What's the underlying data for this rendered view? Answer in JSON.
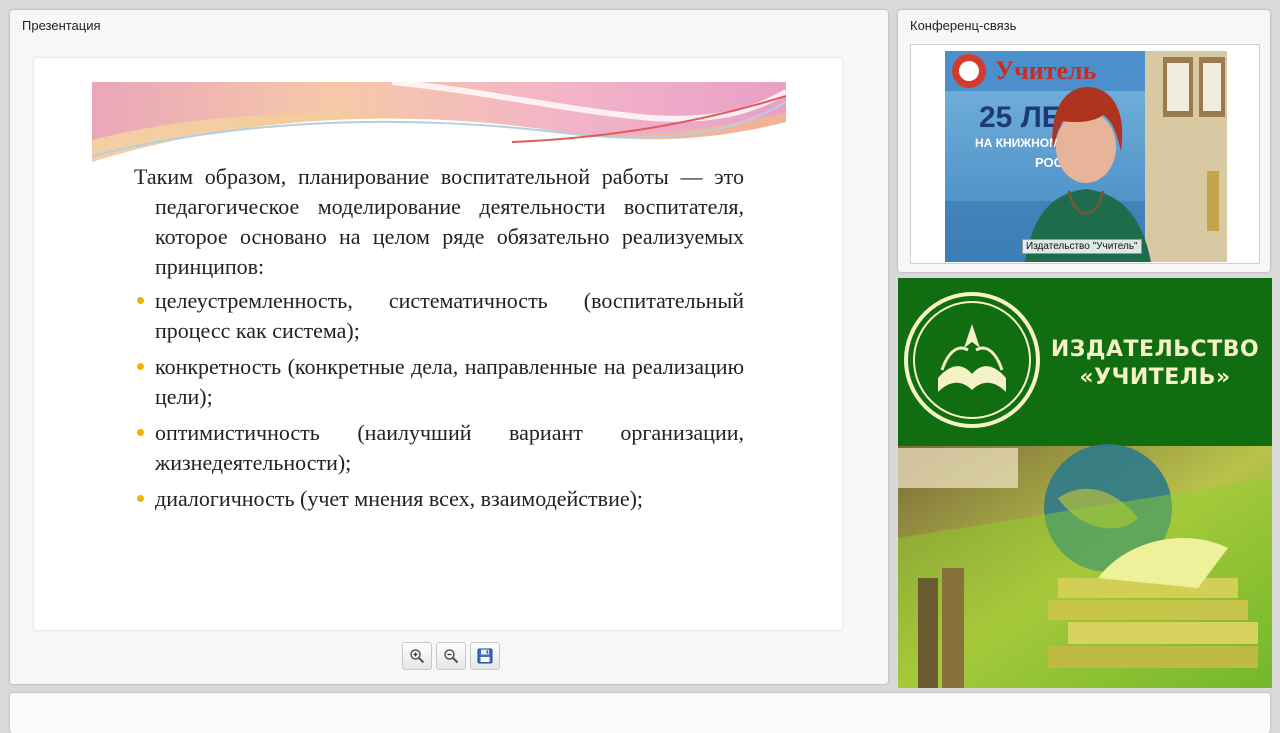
{
  "presentation_panel": {
    "title": "Презентация",
    "slide": {
      "intro": "Таким образом, планирование воспитательной работы — это педагогическое моделирование деятельности воспитателя, которое основано на целом ряде обязательно реализуемых принципов:",
      "bullets": [
        "целеустремленность, систематичность (воспитательный процесс как система);",
        "конкретность (конкретные дела, направленные на реализацию цели);",
        "оптимистичность (наилучший вариант организации, жизнедеятельности);",
        "диалогичность (учет мнения всех, взаимодействие);"
      ]
    },
    "toolbar": {
      "zoom_in_icon": "zoom-in-icon",
      "zoom_out_icon": "zoom-out-icon",
      "save_icon": "floppy-save-icon"
    }
  },
  "conference_panel": {
    "title": "Конференц-связь",
    "speaker_label": "Издательство \"Учитель\"",
    "backdrop_text": {
      "brand": "Учитель",
      "line1": "25 ЛЕТ",
      "line2": "НА КНИЖНОМ Р",
      "line3": "РОСС"
    }
  },
  "publisher_banner": {
    "line1": "ИЗДАТЕЛЬСТВО",
    "line2": "«УЧИТЕЛЬ»",
    "colors": {
      "green": "#106d10",
      "gold": "#f6f2c8"
    }
  },
  "colors": {
    "bullet": "#f0b400",
    "background": "#d9d9d9"
  }
}
